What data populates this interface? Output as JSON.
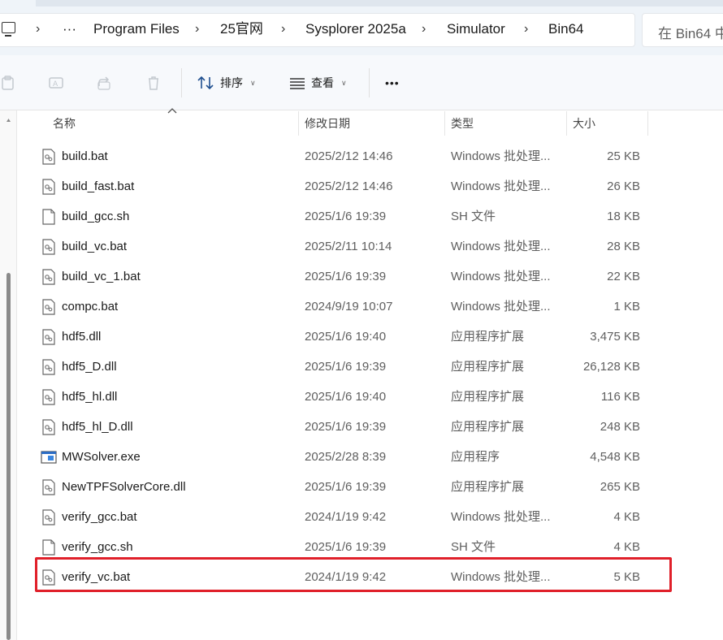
{
  "breadcrumb": {
    "overflow_label": "···",
    "items": [
      "Program Files",
      "25官网",
      "Sysplorer 2025a",
      "Simulator",
      "Bin64"
    ]
  },
  "search": {
    "placeholder": "在 Bin64 中"
  },
  "toolbar": {
    "sort_label": "排序",
    "view_label": "查看",
    "more_label": "•••"
  },
  "columns": {
    "name": "名称",
    "date": "修改日期",
    "type": "类型",
    "size": "大小"
  },
  "files": [
    {
      "name": "build.bat",
      "date": "2025/2/12 14:46",
      "type": "Windows 批处理...",
      "size": "25 KB",
      "icon": "bat-file-icon"
    },
    {
      "name": "build_fast.bat",
      "date": "2025/2/12 14:46",
      "type": "Windows 批处理...",
      "size": "26 KB",
      "icon": "bat-file-icon"
    },
    {
      "name": "build_gcc.sh",
      "date": "2025/1/6 19:39",
      "type": "SH 文件",
      "size": "18 KB",
      "icon": "blank-file-icon"
    },
    {
      "name": "build_vc.bat",
      "date": "2025/2/11 10:14",
      "type": "Windows 批处理...",
      "size": "28 KB",
      "icon": "bat-file-icon"
    },
    {
      "name": "build_vc_1.bat",
      "date": "2025/1/6 19:39",
      "type": "Windows 批处理...",
      "size": "22 KB",
      "icon": "bat-file-icon"
    },
    {
      "name": "compc.bat",
      "date": "2024/9/19 10:07",
      "type": "Windows 批处理...",
      "size": "1 KB",
      "icon": "bat-file-icon"
    },
    {
      "name": "hdf5.dll",
      "date": "2025/1/6 19:40",
      "type": "应用程序扩展",
      "size": "3,475 KB",
      "icon": "dll-file-icon"
    },
    {
      "name": "hdf5_D.dll",
      "date": "2025/1/6 19:39",
      "type": "应用程序扩展",
      "size": "26,128 KB",
      "icon": "dll-file-icon"
    },
    {
      "name": "hdf5_hl.dll",
      "date": "2025/1/6 19:40",
      "type": "应用程序扩展",
      "size": "116 KB",
      "icon": "dll-file-icon"
    },
    {
      "name": "hdf5_hl_D.dll",
      "date": "2025/1/6 19:39",
      "type": "应用程序扩展",
      "size": "248 KB",
      "icon": "dll-file-icon"
    },
    {
      "name": "MWSolver.exe",
      "date": "2025/2/28 8:39",
      "type": "应用程序",
      "size": "4,548 KB",
      "icon": "exe-file-icon"
    },
    {
      "name": "NewTPFSolverCore.dll",
      "date": "2025/1/6 19:39",
      "type": "应用程序扩展",
      "size": "265 KB",
      "icon": "dll-file-icon"
    },
    {
      "name": "verify_gcc.bat",
      "date": "2024/1/19 9:42",
      "type": "Windows 批处理...",
      "size": "4 KB",
      "icon": "bat-file-icon"
    },
    {
      "name": "verify_gcc.sh",
      "date": "2025/1/6 19:39",
      "type": "SH 文件",
      "size": "4 KB",
      "icon": "blank-file-icon"
    },
    {
      "name": "verify_vc.bat",
      "date": "2024/1/19 9:42",
      "type": "Windows 批处理...",
      "size": "5 KB",
      "icon": "bat-file-icon"
    }
  ],
  "colors": {
    "highlight_box": "#e0202a",
    "accent": "#0067c0"
  }
}
